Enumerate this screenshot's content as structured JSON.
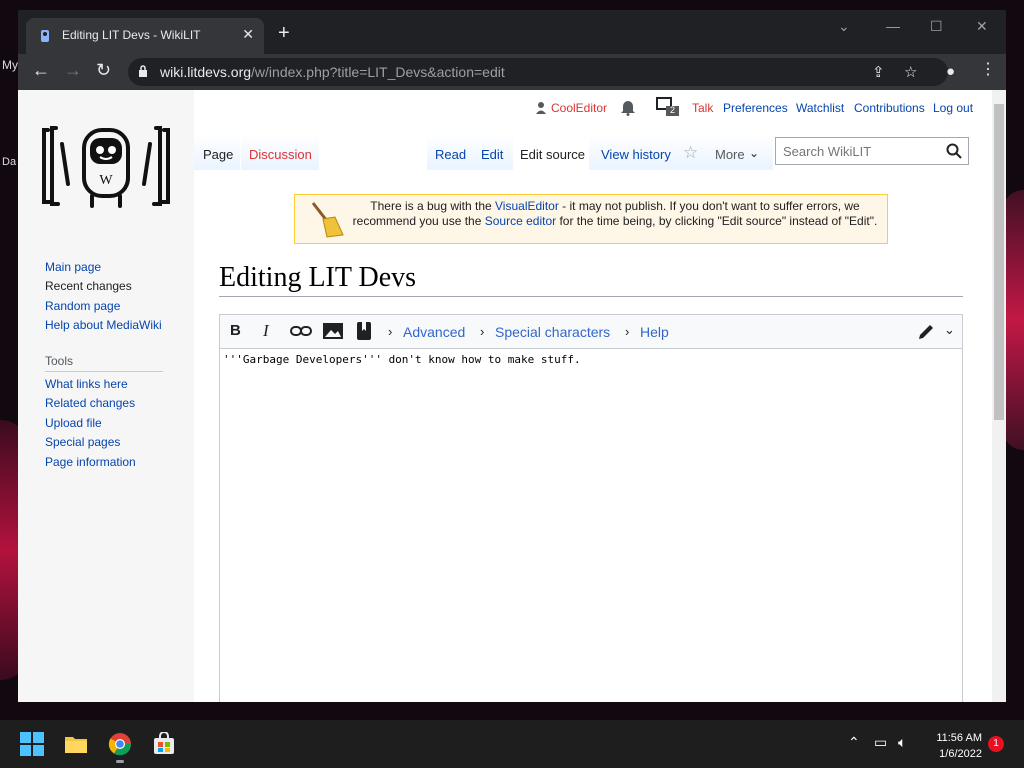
{
  "desktop": {
    "text1": "My",
    "text2": "Da"
  },
  "browser": {
    "tab_title": "Editing LIT Devs - WikiLIT",
    "tab_close": "✕",
    "new_tab": "+",
    "url_host": "wiki.litdevs.org",
    "url_path": "/w/index.php?title=LIT_Devs&action=edit"
  },
  "personal": {
    "user": "CoolEditor",
    "notif_count": "2",
    "talk": "Talk",
    "preferences": "Preferences",
    "watchlist": "Watchlist",
    "contributions": "Contributions",
    "logout": "Log out"
  },
  "tabs": {
    "page": "Page",
    "discussion": "Discussion",
    "read": "Read",
    "edit": "Edit",
    "edit_source": "Edit source",
    "view_history": "View history",
    "more": "More"
  },
  "search": {
    "placeholder": "Search WikiLIT"
  },
  "sidebar": {
    "nav": [
      "Main page",
      "Recent changes",
      "Random page",
      "Help about MediaWiki"
    ],
    "tools_heading": "Tools",
    "tools": [
      "What links here",
      "Related changes",
      "Upload file",
      "Special pages",
      "Page information"
    ]
  },
  "notice": {
    "part1": "There is a bug with the ",
    "link1": "VisualEditor",
    "part2": " - it may not publish. If you don't want to suffer errors, we recommend you use the ",
    "link2": "Source editor",
    "part3": " for the time being, by clicking \"Edit source\" instead of \"Edit\"."
  },
  "heading": "Editing LIT Devs",
  "editor": {
    "bold": "B",
    "italic": "I",
    "advanced": "Advanced",
    "special_chars": "Special characters",
    "help": "Help",
    "content": "'''Garbage Developers''' don't know how to make stuff."
  },
  "taskbar": {
    "time": "11:56 AM",
    "date": "1/6/2022",
    "badge": "1"
  },
  "colors": {
    "link": "#0645ad",
    "redlink": "#d33",
    "editor_link": "#36c"
  }
}
